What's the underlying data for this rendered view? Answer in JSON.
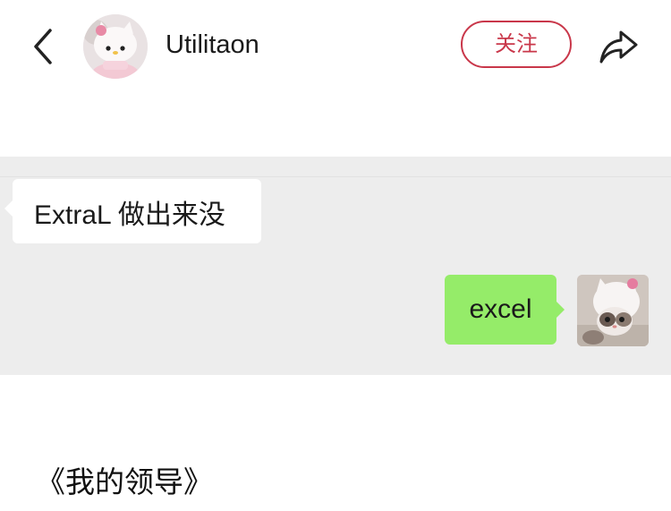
{
  "header": {
    "back_icon": "chevron-left-icon",
    "avatar_icon": "hello-kitty-plush-avatar",
    "username": "Utilitaon",
    "follow_label": "关注",
    "share_icon": "share-arrow-icon",
    "accent_color": "#c9374a"
  },
  "chat": {
    "incoming_message": "ExtraL 做出来没",
    "outgoing_message": "excel",
    "self_avatar_icon": "kitten-in-hello-kitty-hat-avatar",
    "background_color": "#ededed",
    "outgoing_bubble_color": "#95ec69"
  },
  "article": {
    "caption": "《我的领导》"
  }
}
